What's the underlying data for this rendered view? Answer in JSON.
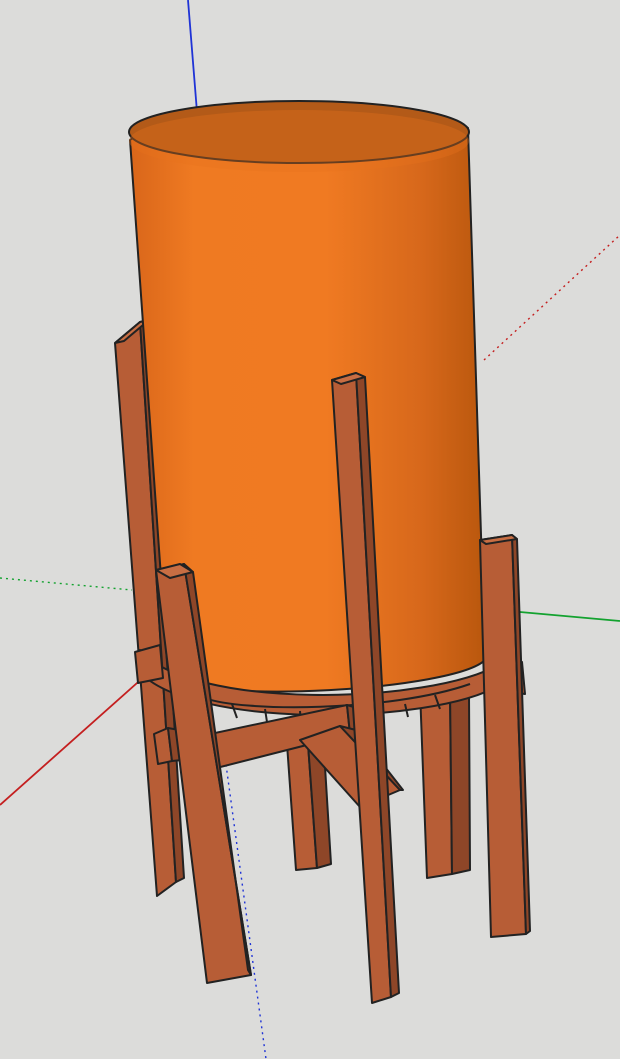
{
  "viewport": {
    "background_color": "#dcdcda"
  },
  "axes": {
    "blue": "#1f33d6",
    "green": "#13a22f",
    "red": "#c41f1f",
    "red_dotted": "#c41f1f",
    "green_dotted": "#13a22f",
    "blue_dotted": "#1f33d6"
  },
  "model": {
    "tank_light": "#f07a22",
    "tank_mid": "#e9741d",
    "tank_dark": "#b9570d",
    "tank_top": "#b35a18",
    "wood_front": "#b75d36",
    "wood_side": "#8e4628",
    "wood_top": "#c86e43",
    "outline": "#222222"
  }
}
